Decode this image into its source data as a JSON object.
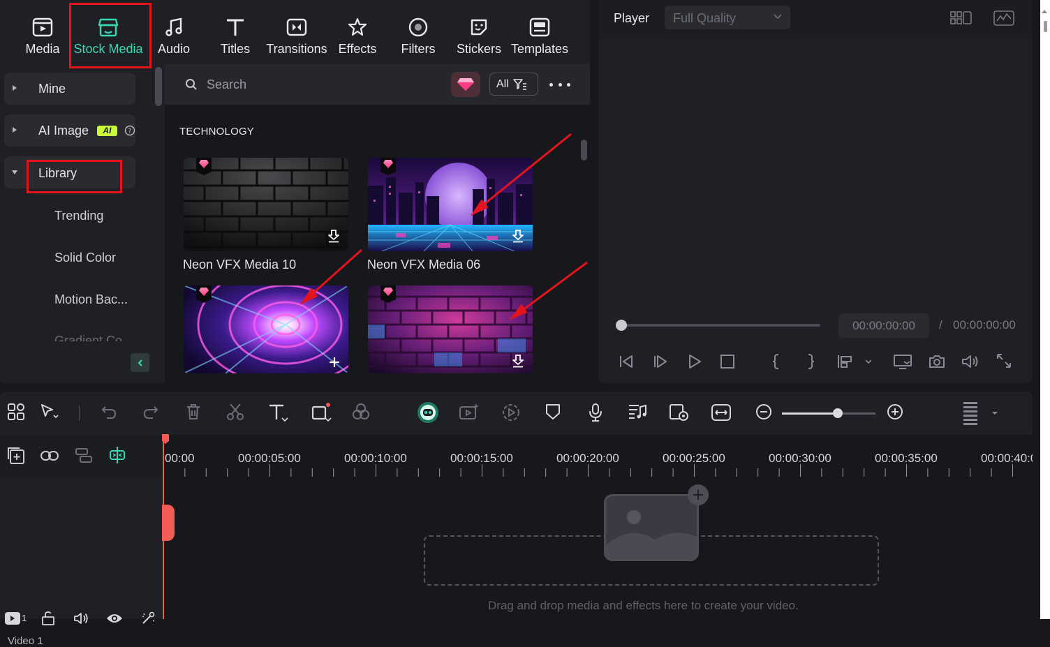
{
  "categories": [
    {
      "label": "Media",
      "icon": "media-icon"
    },
    {
      "label": "Stock Media",
      "icon": "stock-media-icon",
      "active": true
    },
    {
      "label": "Audio",
      "icon": "audio-icon"
    },
    {
      "label": "Titles",
      "icon": "titles-icon"
    },
    {
      "label": "Transitions",
      "icon": "transitions-icon"
    },
    {
      "label": "Effects",
      "icon": "effects-icon"
    },
    {
      "label": "Filters",
      "icon": "filters-icon"
    },
    {
      "label": "Stickers",
      "icon": "stickers-icon"
    },
    {
      "label": "Templates",
      "icon": "templates-icon"
    }
  ],
  "sidebar": {
    "items": [
      {
        "label": "Mine"
      },
      {
        "label": "AI Image",
        "badge": "AI"
      },
      {
        "label": "Library"
      }
    ],
    "sub_items": [
      "Trending",
      "Solid Color",
      "Motion Bac...",
      "Gradient Co..."
    ]
  },
  "search": {
    "placeholder": "Search",
    "filter_label": "All"
  },
  "section": {
    "title": "TECHNOLOGY"
  },
  "thumbnails": [
    {
      "label": "Neon VFX Media 10",
      "action": "download"
    },
    {
      "label": "Neon VFX Media 06",
      "action": "download"
    },
    {
      "label": "",
      "action": "add"
    },
    {
      "label": "",
      "action": "download"
    }
  ],
  "player": {
    "title": "Player",
    "quality": "Full Quality",
    "current_time": "00:00:00:00",
    "separator": "/",
    "total_time": "00:00:00:00"
  },
  "timeline": {
    "ruler_labels": [
      "00:00",
      "00:00:05:00",
      "00:00:10:00",
      "00:00:15:00",
      "00:00:20:00",
      "00:00:25:00",
      "00:00:30:00",
      "00:00:35:00",
      "00:00:40:0"
    ],
    "track_label": "Video 1",
    "track_number": "1",
    "drop_hint": "Drag and drop media and effects here to create your video.",
    "zoom_level": 0.6
  },
  "colors": {
    "accent": "#37d9b5",
    "annotation": "#e3141b",
    "playhead": "#f25c54",
    "ai_badge": "#c8f93b"
  }
}
